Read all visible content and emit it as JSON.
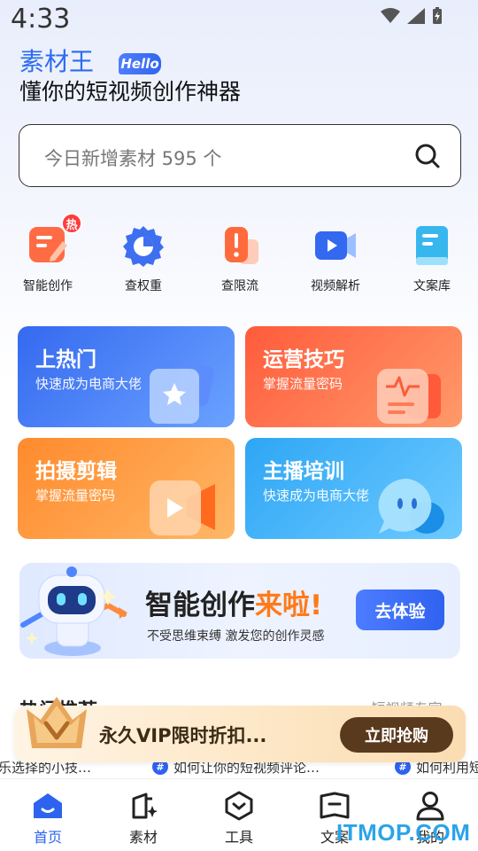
{
  "status": {
    "time": "4:33"
  },
  "header": {
    "brand": "素材王",
    "badge": "Hello",
    "slogan": "懂你的短视频创作神器"
  },
  "search": {
    "placeholder": "今日新增素材 595 个"
  },
  "quick_actions": [
    {
      "label": "智能创作",
      "icon": "smart-create-icon",
      "badge": "热"
    },
    {
      "label": "查权重",
      "icon": "pie-chart-icon"
    },
    {
      "label": "查限流",
      "icon": "alert-icon"
    },
    {
      "label": "视频解析",
      "icon": "video-camera-icon"
    },
    {
      "label": "文案库",
      "icon": "book-icon"
    }
  ],
  "cards": [
    {
      "title": "上热门",
      "subtitle": "快速成为电商大佬",
      "color": "#3f74f2"
    },
    {
      "title": "运营技巧",
      "subtitle": "掌握流量密码",
      "color": "#ff6a3d"
    },
    {
      "title": "拍摄剪辑",
      "subtitle": "掌握流量密码",
      "color": "#ff9a3c"
    },
    {
      "title": "主播培训",
      "subtitle": "快速成为电商大佬",
      "color": "#45b5f6"
    }
  ],
  "banner": {
    "title_main": "智能创作",
    "title_accent": "来啦!",
    "subtitle": "不受思维束缚 激发您的创作灵感",
    "button": "去体验"
  },
  "section": {
    "title": "热门推荐",
    "more": "短视频专家 >"
  },
  "articles": [
    {
      "text": "乐选择的小技…"
    },
    {
      "text": "如何让你的短视频评论…"
    },
    {
      "text": "如何利用短"
    }
  ],
  "vip": {
    "text": "永久VIP限时折扣...",
    "button": "立即抢购"
  },
  "nav": [
    {
      "label": "首页",
      "icon": "home-icon",
      "active": true
    },
    {
      "label": "素材",
      "icon": "material-icon"
    },
    {
      "label": "工具",
      "icon": "tools-icon"
    },
    {
      "label": "文案",
      "icon": "copywriting-icon"
    },
    {
      "label": "我的",
      "icon": "profile-icon"
    }
  ],
  "watermark": "ITMOP.COM"
}
